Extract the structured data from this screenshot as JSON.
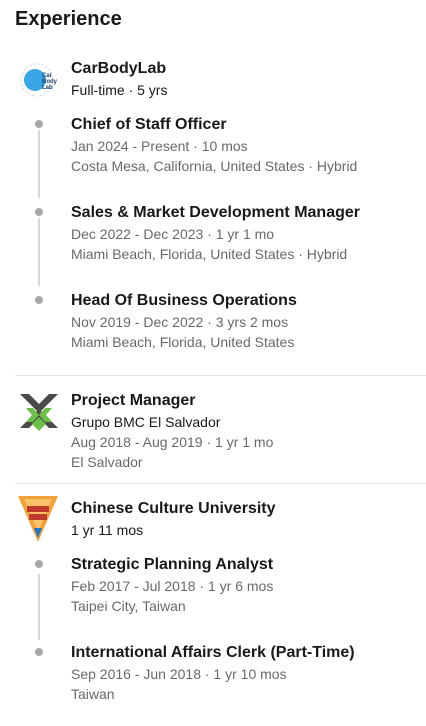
{
  "section": {
    "title": "Experience"
  },
  "companies": [
    {
      "name": "CarBodyLab",
      "summary": "Full-time · 5 yrs",
      "logo_text": "Car Body Lab",
      "roles": [
        {
          "title": "Chief of Staff Officer",
          "dates": "Jan 2024 - Present · 10 mos",
          "location": "Costa Mesa, California, United States · Hybrid"
        },
        {
          "title": "Sales & Market Development Manager",
          "dates": "Dec 2022 - Dec 2023 · 1 yr 1 mo",
          "location": "Miami Beach, Florida, United States · Hybrid"
        },
        {
          "title": "Head Of Business Operations",
          "dates": "Nov 2019 - Dec 2022 · 3 yrs 2 mos",
          "location": "Miami Beach, Florida, United States"
        }
      ]
    },
    {
      "name": "Project Manager",
      "company": "Grupo BMC El Salvador",
      "dates": "Aug 2018 - Aug 2019 · 1 yr 1 mo",
      "location": "El Salvador"
    },
    {
      "name": "Chinese Culture University",
      "summary": "1 yr 11 mos",
      "roles": [
        {
          "title": "Strategic Planning Analyst",
          "dates": "Feb 2017 - Jul 2018 · 1 yr 6 mos",
          "location": "Taipei City, Taiwan"
        },
        {
          "title": "International Affairs Clerk (Part-Time)",
          "dates": "Sep 2016 - Jun 2018 · 1 yr 10 mos",
          "location": "Taiwan"
        }
      ]
    }
  ],
  "colors": {
    "timeline_dot": "#a8a8a8",
    "timeline_line": "#d6d6d6",
    "divider": "#e3e3e3",
    "bmc_green": "#6cc04a",
    "bmc_dark": "#4a4a4a",
    "ccu_orange": "#f2a23a",
    "ccu_blue": "#1f78c8"
  }
}
